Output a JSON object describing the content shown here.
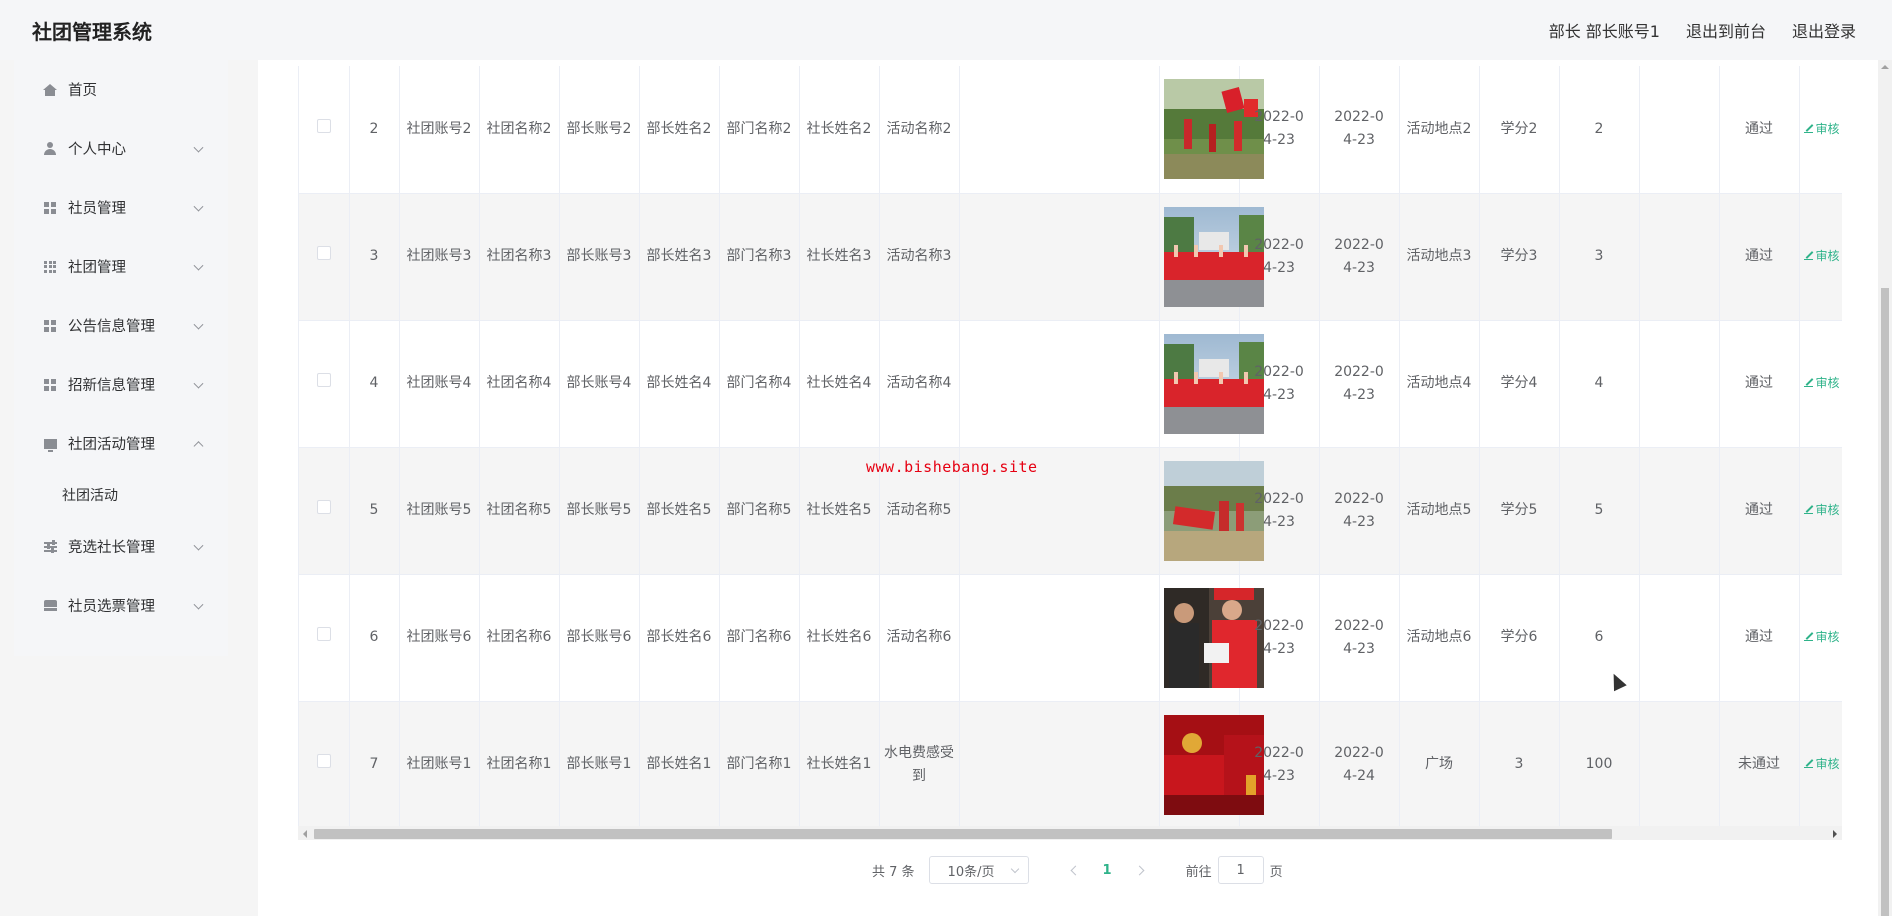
{
  "header": {
    "brand": "社团管理系统",
    "user_label": "部长 部长账号1",
    "to_front_label": "退出到前台",
    "logout_label": "退出登录"
  },
  "sidebar": {
    "items": [
      {
        "label": "首页",
        "icon": "home-icon",
        "has_children": false
      },
      {
        "label": "个人中心",
        "icon": "user-icon",
        "has_children": true
      },
      {
        "label": "社员管理",
        "icon": "grid-icon",
        "has_children": true
      },
      {
        "label": "社团管理",
        "icon": "apps-icon",
        "has_children": true
      },
      {
        "label": "公告信息管理",
        "icon": "grid-icon",
        "has_children": true
      },
      {
        "label": "招新信息管理",
        "icon": "grid-icon",
        "has_children": true
      },
      {
        "label": "社团活动管理",
        "icon": "monitor-icon",
        "has_children": true,
        "expanded": true
      },
      {
        "label": "竞选社长管理",
        "icon": "sliders-icon",
        "has_children": true
      },
      {
        "label": "社员选票管理",
        "icon": "box-icon",
        "has_children": true
      }
    ],
    "sub_items": [
      {
        "label": "社团活动"
      }
    ]
  },
  "table": {
    "action_label": "审核",
    "rows": [
      {
        "index": "2",
        "club_account": "社团账号2",
        "club_name": "社团名称2",
        "minister_account": "部长账号2",
        "minister_name": "部长姓名2",
        "dept_name": "部门名称2",
        "president_name": "社长姓名2",
        "activity_name": "活动名称2",
        "photo": "photo-flags-field",
        "start_date": "2022-04-23",
        "end_date": "2022-04-23",
        "location": "活动地点2",
        "credit": "学分2",
        "count": "2",
        "status": "通过"
      },
      {
        "index": "3",
        "club_account": "社团账号3",
        "club_name": "社团名称3",
        "minister_account": "部长账号3",
        "minister_name": "部长姓名3",
        "dept_name": "部门名称3",
        "president_name": "社长姓名3",
        "activity_name": "活动名称3",
        "photo": "photo-group-road",
        "start_date": "2022-04-23",
        "end_date": "2022-04-23",
        "location": "活动地点3",
        "credit": "学分3",
        "count": "3",
        "status": "通过"
      },
      {
        "index": "4",
        "club_account": "社团账号4",
        "club_name": "社团名称4",
        "minister_account": "部长账号4",
        "minister_name": "部长姓名4",
        "dept_name": "部门名称4",
        "president_name": "社长姓名4",
        "activity_name": "活动名称4",
        "photo": "photo-group-road",
        "start_date": "2022-04-23",
        "end_date": "2022-04-23",
        "location": "活动地点4",
        "credit": "学分4",
        "count": "4",
        "status": "通过"
      },
      {
        "index": "5",
        "club_account": "社团账号5",
        "club_name": "社团名称5",
        "minister_account": "部长账号5",
        "minister_name": "部长姓名5",
        "dept_name": "部门名称5",
        "president_name": "社长姓名5",
        "activity_name": "活动名称5",
        "photo": "photo-banner-grass",
        "start_date": "2022-04-23",
        "end_date": "2022-04-23",
        "location": "活动地点5",
        "credit": "学分5",
        "count": "5",
        "status": "通过"
      },
      {
        "index": "6",
        "club_account": "社团账号6",
        "club_name": "社团名称6",
        "minister_account": "部长账号6",
        "minister_name": "部长姓名6",
        "dept_name": "部门名称6",
        "president_name": "社长姓名6",
        "activity_name": "活动名称6",
        "photo": "photo-volunteer",
        "start_date": "2022-04-23",
        "end_date": "2022-04-23",
        "location": "活动地点6",
        "credit": "学分6",
        "count": "6",
        "status": "通过"
      },
      {
        "index": "7",
        "club_account": "社团账号1",
        "club_name": "社团名称1",
        "minister_account": "部长账号1",
        "minister_name": "部长姓名1",
        "dept_name": "部门名称1",
        "president_name": "社长姓名1",
        "activity_name": "水电费感受到",
        "photo": "photo-red-flag",
        "start_date": "2022-04-23",
        "end_date": "2022-04-24",
        "location": "广场",
        "credit": "3",
        "count": "100",
        "status": "未通过"
      }
    ]
  },
  "pagination": {
    "total_label": "共 7 条",
    "page_size_label": "10条/页",
    "current_page": "1",
    "goto_label": "前往",
    "goto_value": "1",
    "page_unit": "页"
  },
  "watermark": "www.bishebang.site",
  "colors": {
    "accent": "#2fb38a",
    "watermark": "#e60012"
  }
}
